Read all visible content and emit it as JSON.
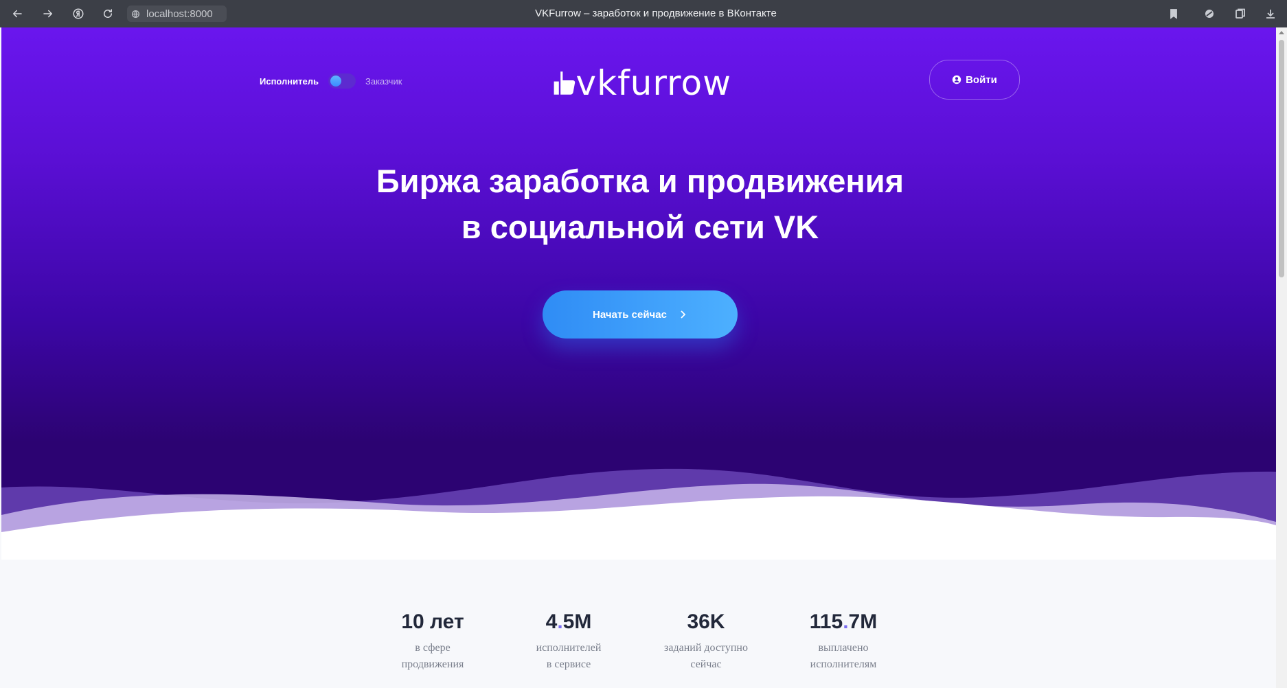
{
  "browser": {
    "url": "localhost:8000",
    "tab_title": "VKFurrow – заработок и продвижение в ВКонтакте",
    "icons": [
      "back-icon",
      "forward-icon",
      "yandex-icon",
      "reload-icon",
      "bookmark-icon",
      "extension-icon",
      "collections-icon",
      "download-icon"
    ]
  },
  "header": {
    "role_performer": "Исполнитель",
    "role_customer": "Заказчик",
    "logo_text": "vkfurrow",
    "login_label": "Войти"
  },
  "hero": {
    "title_line1": "Биржа заработка и продвижения",
    "title_line2": "в социальной сети VK",
    "cta_label": "Начать сейчас"
  },
  "stats": [
    {
      "value_a": "10 лет",
      "value_dot": "",
      "value_b": "",
      "line1": "в сфере",
      "line2": "продвижения"
    },
    {
      "value_a": "4",
      "value_dot": ".",
      "value_b": "5M",
      "line1": "исполнителей",
      "line2": "в сервисе"
    },
    {
      "value_a": "36K",
      "value_dot": "",
      "value_b": "",
      "line1": "заданий доступно",
      "line2": "сейчас"
    },
    {
      "value_a": "115",
      "value_dot": ".",
      "value_b": "7M",
      "line1": "выплачено",
      "line2": "исполнителям"
    }
  ],
  "colors": {
    "hero_top": "#6a16ee",
    "hero_bottom": "#2c0372",
    "cta_start": "#2f8cf5",
    "cta_end": "#4db0ff",
    "stat_dot": "#7a6cf0",
    "stat_value": "#22283a"
  }
}
